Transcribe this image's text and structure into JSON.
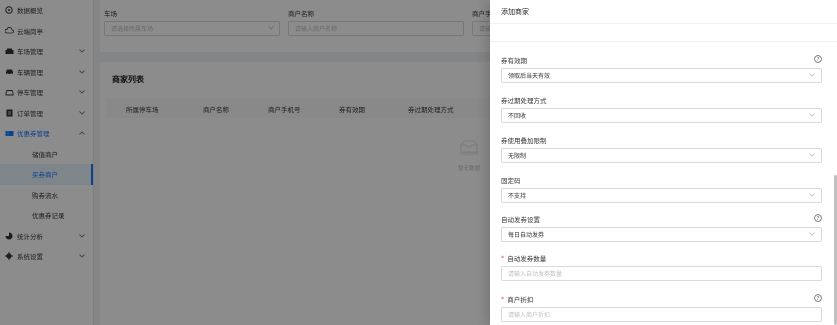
{
  "sidebar": {
    "items": [
      {
        "label": "数据概览",
        "icon": "dashboard-icon"
      },
      {
        "label": "云端岗亭",
        "icon": "cloud-icon"
      },
      {
        "label": "车场管理",
        "icon": "parking-icon"
      },
      {
        "label": "车辆管理",
        "icon": "car-icon"
      },
      {
        "label": "停车管理",
        "icon": "park-car-icon"
      },
      {
        "label": "订单管理",
        "icon": "order-icon"
      },
      {
        "label": "优惠券管理",
        "icon": "coupon-icon"
      },
      {
        "label": "储值商户"
      },
      {
        "label": "买券商户"
      },
      {
        "label": "购券流水"
      },
      {
        "label": "优惠券记录"
      },
      {
        "label": "统计分析",
        "icon": "chart-icon"
      },
      {
        "label": "系统设置",
        "icon": "settings-icon"
      }
    ]
  },
  "filters": {
    "parking_label": "车场",
    "parking_placeholder": "请选择所属车场",
    "merchant_label": "商户名称",
    "merchant_placeholder": "请输入商户名称",
    "phone_label": "商户手",
    "phone_placeholder": "请输"
  },
  "list": {
    "title": "商家列表",
    "columns": [
      "所属停车场",
      "商户名称",
      "商户手机号",
      "券有效期",
      "券过期处理方式"
    ],
    "empty_text": "暂无数据"
  },
  "drawer": {
    "title": "添加商家",
    "fields": [
      {
        "label": "券有效期",
        "value": "领取后当天有效",
        "required": false
      },
      {
        "label": "券过期处理方式",
        "value": "不回收",
        "required": false
      },
      {
        "label": "券使用叠加限制",
        "value": "无限制",
        "required": false
      },
      {
        "label": "固定码",
        "value": "不支持",
        "required": false
      },
      {
        "label": "自动发券设置",
        "value": "每日自动发券",
        "required": false
      },
      {
        "label": "自动发券数量",
        "placeholder": "请输入自动发券数量",
        "required": true
      },
      {
        "label": "商户折扣",
        "placeholder": "请输入商户折扣",
        "required": true
      }
    ]
  },
  "colors": {
    "primary": "#1677ff",
    "required": "#ff4d4f",
    "overlay": "rgba(0,0,0,0.45)"
  }
}
